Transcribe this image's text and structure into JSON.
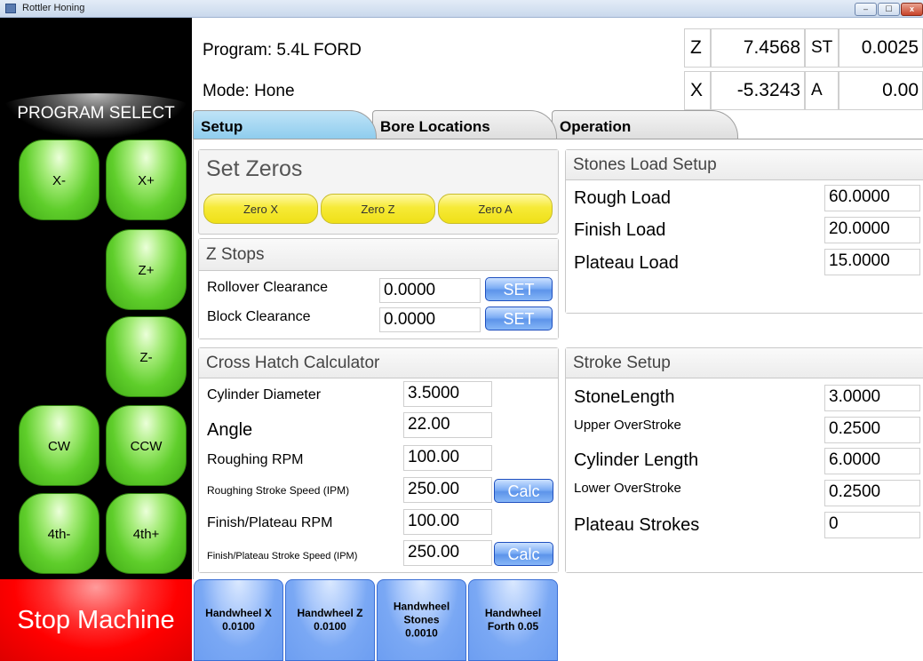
{
  "window": {
    "title": "Rottler Honing",
    "min": "–",
    "max": "☐",
    "close": "x"
  },
  "left": {
    "program_select": "PROGRAM SELECT",
    "jog": {
      "x_minus": "X-",
      "x_plus": "X+",
      "z_plus": "Z+",
      "z_minus": "Z-",
      "cw": "CW",
      "ccw": "CCW",
      "fourth_minus": "4th-",
      "fourth_plus": "4th+"
    },
    "stop": "Stop Machine"
  },
  "header": {
    "program": "Program: 5.4L FORD",
    "mode": "Mode: Hone",
    "coords": {
      "z_label": "Z",
      "z_value": "7.4568",
      "st_label": "ST",
      "st_value": "0.0025",
      "x_label": "X",
      "x_value": "-5.3243",
      "a_label": "A",
      "a_value": "0.00"
    }
  },
  "tabs": {
    "setup": "Setup",
    "bore": "Bore Locations",
    "operation": "Operation"
  },
  "set_zeros": {
    "title": "Set Zeros",
    "zero_x": "Zero X",
    "zero_z": "Zero Z",
    "zero_a": "Zero A"
  },
  "z_stops": {
    "title": "Z Stops",
    "rollover_label": "Rollover Clearance",
    "rollover_value": "0.0000",
    "block_label": "Block Clearance",
    "block_value": "0.0000",
    "set": "SET"
  },
  "cross_hatch": {
    "title": "Cross Hatch Calculator",
    "cyl_diam_label": "Cylinder Diameter",
    "cyl_diam_value": "3.5000",
    "angle_label": "Angle",
    "angle_value": "22.00",
    "rough_rpm_label": "Roughing RPM",
    "rough_rpm_value": "100.00",
    "rough_speed_label": "Roughing Stroke Speed (IPM)",
    "rough_speed_value": "250.00",
    "finish_rpm_label": "Finish/Plateau RPM",
    "finish_rpm_value": "100.00",
    "finish_speed_label": "Finish/Plateau Stroke Speed (IPM)",
    "finish_speed_value": "250.00",
    "calc": "Calc"
  },
  "stones_load": {
    "title": "Stones Load Setup",
    "rough_label": "Rough Load",
    "rough_value": "60.0000",
    "finish_label": "Finish Load",
    "finish_value": "20.0000",
    "plateau_label": "Plateau Load",
    "plateau_value": "15.0000"
  },
  "stroke": {
    "title": "Stroke Setup",
    "stone_len_label": "StoneLength",
    "stone_len_value": "3.0000",
    "upper_label": "Upper OverStroke",
    "upper_value": "0.2500",
    "cyl_len_label": "Cylinder Length",
    "cyl_len_value": "6.0000",
    "lower_label": "Lower OverStroke",
    "lower_value": "0.2500",
    "plateau_label": "Plateau Strokes",
    "plateau_value": "0"
  },
  "handwheels": {
    "x_title": "Handwheel X",
    "x_value": "0.0100",
    "z_title": "Handwheel Z",
    "z_value": "0.0100",
    "stones_title1": "Handwheel",
    "stones_title2": "Stones",
    "stones_value": "0.0010",
    "forth_title": "Handwheel",
    "forth_value": "Forth 0.05"
  }
}
